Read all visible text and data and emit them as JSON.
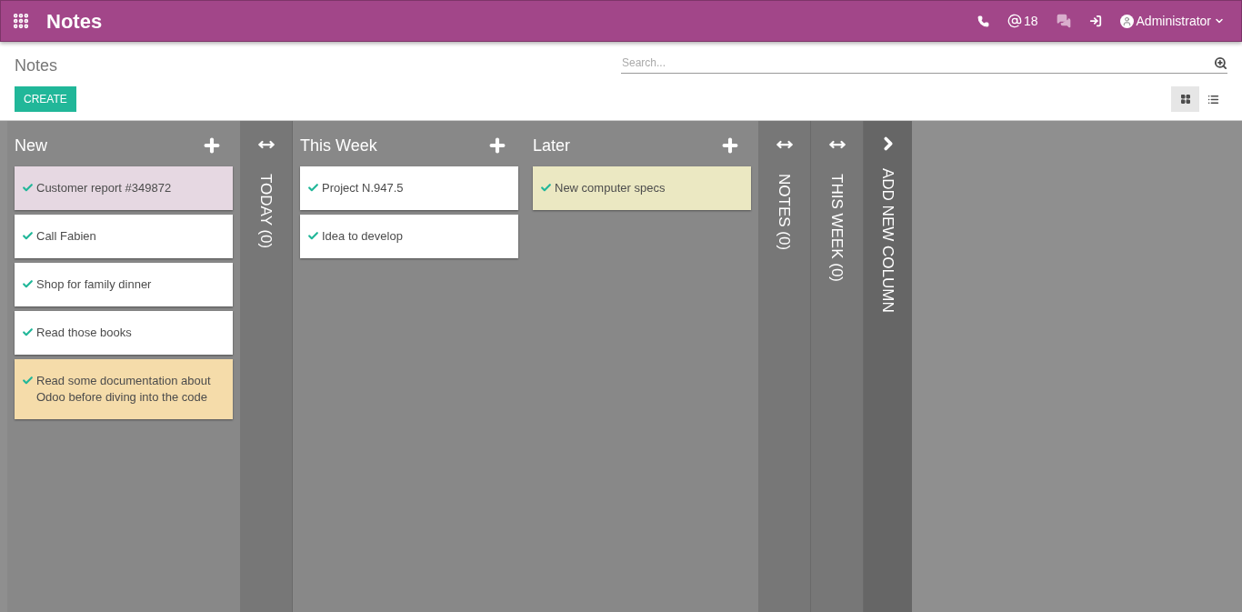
{
  "app_title": "Notes",
  "systray": {
    "mentions": "18",
    "user": "Administrator"
  },
  "breadcrumb": "Notes",
  "search": {
    "placeholder": "Search..."
  },
  "create_button": "CREATE",
  "views": [
    {
      "kind": "kanban",
      "selected": true
    },
    {
      "kind": "list",
      "selected": false
    }
  ],
  "columns": [
    {
      "kind": "open",
      "title": "New",
      "notes": [
        {
          "text": "Customer report #349872",
          "color": "#e6d8e2"
        },
        {
          "text": "Call Fabien",
          "color": "#ffffff"
        },
        {
          "text": "Shop for family dinner",
          "color": "#ffffff"
        },
        {
          "text": "Read those books",
          "color": "#ffffff"
        },
        {
          "text": "Read some documentation about Odoo before diving into the code",
          "color": "#f5dcaa"
        }
      ]
    },
    {
      "kind": "folded",
      "title": "TODAY (0)"
    },
    {
      "kind": "open",
      "title": "This Week",
      "notes": [
        {
          "text": "Project N.947.5",
          "color": "#ffffff"
        },
        {
          "text": "Idea to develop",
          "color": "#ffffff"
        }
      ]
    },
    {
      "kind": "open",
      "title": "Later",
      "notes": [
        {
          "text": "New computer specs",
          "color": "#ebe8c2"
        }
      ]
    },
    {
      "kind": "folded",
      "title": "NOTES (0)"
    },
    {
      "kind": "folded",
      "title": "THIS WEEK (0)"
    }
  ],
  "add_column": "ADD NEW COLUMN"
}
